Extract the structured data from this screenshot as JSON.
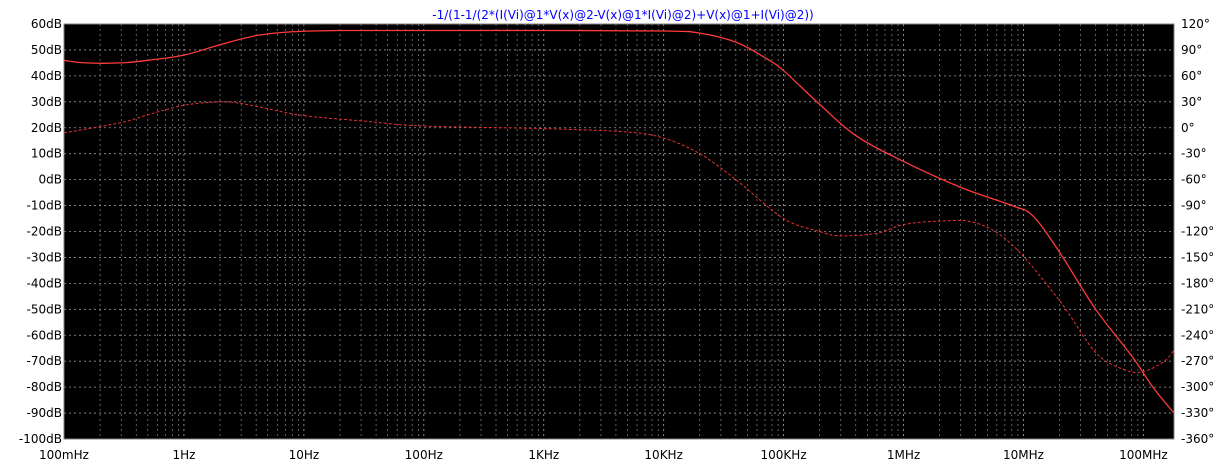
{
  "trace_expression": "-1/(1-1/(2*(I(Vi)@1*V(x)@2-V(x)@1*I(Vi)@2)+V(x)@1+I(Vi)@2))",
  "colors": {
    "plot_background": "#000000",
    "grid": "#9a9a9a",
    "magnitude_trace": "#ff3b3b",
    "phase_trace": "#e83030",
    "title_text": "#0000ff",
    "window_background": "#ffffff",
    "label_text": "#000000"
  },
  "chart_data": {
    "type": "line",
    "title": "-1/(1-1/(2*(I(Vi)@1*V(x)@2-V(x)@1*I(Vi)@2)+V(x)@1+I(Vi)@2))",
    "x_scale": "log",
    "x_range_hz": [
      0.1,
      180000000
    ],
    "x_tick_values": [
      0.1,
      1,
      10,
      100,
      1000,
      10000,
      100000,
      1000000,
      10000000,
      100000000
    ],
    "x_tick_labels": [
      "100mHz",
      "1Hz",
      "10Hz",
      "100Hz",
      "1KHz",
      "10KHz",
      "100KHz",
      "1MHz",
      "10MHz",
      "100MHz"
    ],
    "left_axis": {
      "range": [
        -100,
        60
      ],
      "ticks": [
        60,
        50,
        40,
        30,
        20,
        10,
        0,
        -10,
        -20,
        -30,
        -40,
        -50,
        -60,
        -70,
        -80,
        -90,
        -100
      ],
      "tick_labels": [
        "60dB",
        "50dB",
        "40dB",
        "30dB",
        "20dB",
        "10dB",
        "0dB",
        "-10dB",
        "-20dB",
        "-30dB",
        "-40dB",
        "-50dB",
        "-60dB",
        "-70dB",
        "-80dB",
        "-90dB",
        "-100dB"
      ]
    },
    "right_axis": {
      "range": [
        -360,
        120
      ],
      "ticks": [
        120,
        90,
        60,
        30,
        0,
        -30,
        -60,
        -90,
        -120,
        -150,
        -180,
        -210,
        -240,
        -270,
        -300,
        -330,
        -360
      ],
      "tick_labels": [
        "120°",
        "90°",
        "60°",
        "30°",
        "0°",
        "-30°",
        "-60°",
        "-90°",
        "-120°",
        "-150°",
        "-180°",
        "-210°",
        "-240°",
        "-270°",
        "-300°",
        "-330°",
        "-360°"
      ]
    },
    "grid": true,
    "series": [
      {
        "style": "solid",
        "axis": "left",
        "points": [
          [
            0.1,
            46
          ],
          [
            0.15,
            45
          ],
          [
            0.3,
            45
          ],
          [
            0.5,
            46
          ],
          [
            1,
            48
          ],
          [
            2,
            52
          ],
          [
            4,
            55.5
          ],
          [
            8,
            57
          ],
          [
            20,
            57.5
          ],
          [
            100,
            57.5
          ],
          [
            1000,
            57.5
          ],
          [
            10000,
            57.3
          ],
          [
            20000,
            56.5
          ],
          [
            40000,
            53
          ],
          [
            70000,
            47
          ],
          [
            100000,
            42
          ],
          [
            200000,
            29
          ],
          [
            400000,
            17
          ],
          [
            1000000,
            7
          ],
          [
            3000000,
            -3
          ],
          [
            8000000,
            -10
          ],
          [
            12000000,
            -14
          ],
          [
            20000000,
            -28
          ],
          [
            40000000,
            -50
          ],
          [
            80000000,
            -68
          ],
          [
            120000000,
            -80
          ],
          [
            180000000,
            -90
          ]
        ]
      },
      {
        "style": "dashed",
        "axis": "right",
        "points": [
          [
            0.1,
            -6
          ],
          [
            0.3,
            6
          ],
          [
            0.5,
            15
          ],
          [
            1,
            26
          ],
          [
            2,
            30
          ],
          [
            3,
            28
          ],
          [
            5,
            22
          ],
          [
            10,
            14
          ],
          [
            30,
            8
          ],
          [
            100,
            2
          ],
          [
            1000,
            -1
          ],
          [
            5000,
            -5
          ],
          [
            10000,
            -12
          ],
          [
            20000,
            -30
          ],
          [
            40000,
            -60
          ],
          [
            100000,
            -105
          ],
          [
            200000,
            -120
          ],
          [
            300000,
            -125
          ],
          [
            600000,
            -122
          ],
          [
            1000000,
            -112
          ],
          [
            2000000,
            -108
          ],
          [
            4000000,
            -110
          ],
          [
            8000000,
            -135
          ],
          [
            20000000,
            -200
          ],
          [
            40000000,
            -260
          ],
          [
            70000000,
            -280
          ],
          [
            100000000,
            -282
          ],
          [
            150000000,
            -270
          ],
          [
            180000000,
            -257
          ]
        ]
      }
    ]
  }
}
